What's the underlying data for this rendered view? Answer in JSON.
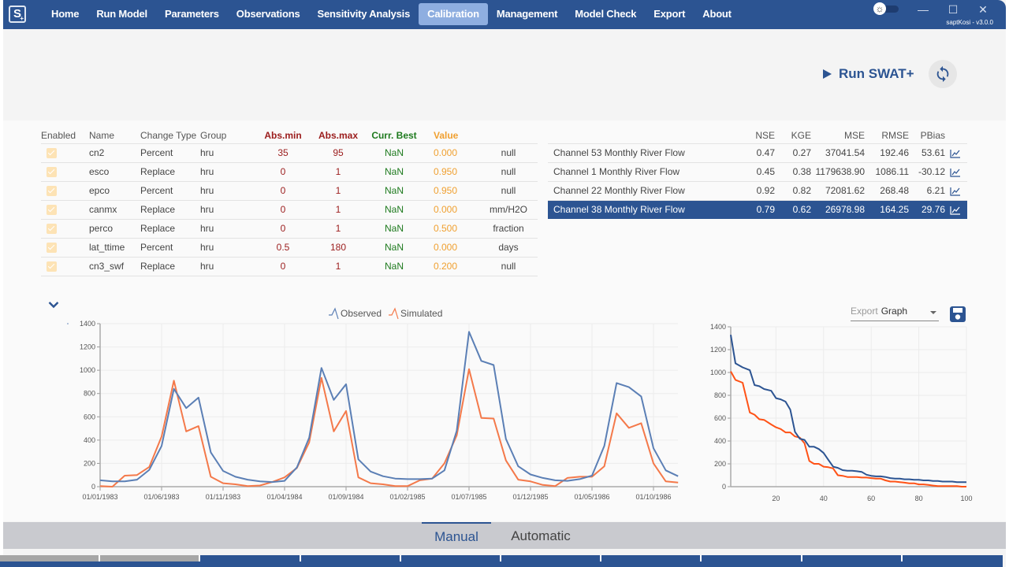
{
  "app": {
    "logo_text": "S",
    "logo_sub": "+",
    "project": "saptKosi",
    "version_label": "saptKosi  - v3.0.0"
  },
  "nav": {
    "items": [
      {
        "label": "Home"
      },
      {
        "label": "Run Model"
      },
      {
        "label": "Parameters"
      },
      {
        "label": "Observations"
      },
      {
        "label": "Sensitivity Analysis"
      },
      {
        "label": "Calibration",
        "active": true
      },
      {
        "label": "Management"
      },
      {
        "label": "Model Check"
      },
      {
        "label": "Export"
      },
      {
        "label": "About"
      }
    ]
  },
  "window": {
    "minimize": "—",
    "maximize": "☐",
    "close": "✕"
  },
  "actions": {
    "run_label": "Run SWAT+",
    "refresh_icon": "refresh-icon"
  },
  "params_table": {
    "headers": {
      "enabled": "Enabled",
      "name": "Name",
      "change_type": "Change Type",
      "group": "Group",
      "abs_min": "Abs.min",
      "abs_max": "Abs.max",
      "curr_best": "Curr. Best",
      "value": "Value"
    },
    "rows": [
      {
        "enabled": true,
        "name": "cn2",
        "change_type": "Percent",
        "group": "hru",
        "abs_min": "35",
        "abs_max": "95",
        "curr_best": "NaN",
        "value": "0.000",
        "unit": "null"
      },
      {
        "enabled": true,
        "name": "esco",
        "change_type": "Replace",
        "group": "hru",
        "abs_min": "0",
        "abs_max": "1",
        "curr_best": "NaN",
        "value": "0.950",
        "unit": "null"
      },
      {
        "enabled": true,
        "name": "epco",
        "change_type": "Percent",
        "group": "hru",
        "abs_min": "0",
        "abs_max": "1",
        "curr_best": "NaN",
        "value": "0.950",
        "unit": "null"
      },
      {
        "enabled": true,
        "name": "canmx",
        "change_type": "Replace",
        "group": "hru",
        "abs_min": "0",
        "abs_max": "1",
        "curr_best": "NaN",
        "value": "0.000",
        "unit": "mm/H2O"
      },
      {
        "enabled": true,
        "name": "perco",
        "change_type": "Replace",
        "group": "hru",
        "abs_min": "0",
        "abs_max": "1",
        "curr_best": "NaN",
        "value": "0.500",
        "unit": "fraction"
      },
      {
        "enabled": true,
        "name": "lat_ttime",
        "change_type": "Percent",
        "group": "hru",
        "abs_min": "0.5",
        "abs_max": "180",
        "curr_best": "NaN",
        "value": "0.000",
        "unit": "days"
      },
      {
        "enabled": true,
        "name": "cn3_swf",
        "change_type": "Replace",
        "group": "hru",
        "abs_min": "0",
        "abs_max": "1",
        "curr_best": "NaN",
        "value": "0.200",
        "unit": "null"
      }
    ]
  },
  "metrics_table": {
    "headers": {
      "nse": "NSE",
      "kge": "KGE",
      "mse": "MSE",
      "rmse": "RMSE",
      "pbias": "PBias"
    },
    "rows": [
      {
        "name": "Channel 53 Monthly River Flow",
        "nse": "0.47",
        "kge": "0.27",
        "mse": "37041.54",
        "rmse": "192.46",
        "pbias": "53.61",
        "selected": false
      },
      {
        "name": "Channel 1 Monthly River Flow",
        "nse": "0.45",
        "kge": "0.38",
        "mse": "1179638.90",
        "rmse": "1086.11",
        "pbias": "-30.12",
        "selected": false
      },
      {
        "name": "Channel 22 Monthly River Flow",
        "nse": "0.92",
        "kge": "0.82",
        "mse": "72081.62",
        "rmse": "268.48",
        "pbias": "6.21",
        "selected": false
      },
      {
        "name": "Channel 38 Monthly River Flow",
        "nse": "0.79",
        "kge": "0.62",
        "mse": "26978.98",
        "rmse": "164.25",
        "pbias": "29.76",
        "selected": true
      }
    ]
  },
  "export": {
    "label": "Export",
    "value": "Graph"
  },
  "colors": {
    "primary": "#2c5492",
    "observed": "#5b7fb5",
    "simulated": "#f4794a",
    "fdc_observed": "#2c5492",
    "fdc_simulated": "#ff5216",
    "nav_active": "#8eaee0"
  },
  "tabs": [
    {
      "label": "Manual",
      "active": true
    },
    {
      "label": "Automatic",
      "active": false
    }
  ],
  "chart_data": [
    {
      "type": "line",
      "title": "",
      "xlabel": "",
      "ylabel": "",
      "legend": [
        "Observed",
        "Simulated"
      ],
      "legend_position": "top-center",
      "ylim": [
        0,
        1400
      ],
      "yticks": [
        0,
        200,
        400,
        600,
        800,
        1000,
        1200,
        1400
      ],
      "x_start": "01/01/1983",
      "x_interval": "monthly",
      "xtick_labels": [
        "01/01/1983",
        "01/06/1983",
        "01/11/1983",
        "01/04/1984",
        "01/09/1984",
        "01/02/1985",
        "01/07/1985",
        "01/12/1985",
        "01/05/1986",
        "01/10/1986"
      ],
      "xtick_index": [
        0,
        5,
        10,
        15,
        20,
        25,
        30,
        35,
        40,
        45
      ],
      "grid": true,
      "series": [
        {
          "name": "Observed",
          "values": [
            55,
            45,
            45,
            60,
            145,
            350,
            840,
            675,
            765,
            295,
            135,
            85,
            60,
            45,
            40,
            50,
            165,
            420,
            1020,
            745,
            880,
            235,
            130,
            90,
            70,
            65,
            65,
            70,
            140,
            480,
            1330,
            1080,
            1045,
            410,
            175,
            105,
            75,
            55,
            50,
            65,
            95,
            350,
            890,
            855,
            775,
            330,
            140,
            90
          ]
        },
        {
          "name": "Simulated",
          "values": [
            5,
            0,
            95,
            100,
            170,
            430,
            910,
            475,
            520,
            85,
            30,
            20,
            5,
            10,
            40,
            80,
            160,
            380,
            935,
            475,
            650,
            80,
            30,
            20,
            5,
            5,
            55,
            70,
            200,
            440,
            1010,
            590,
            585,
            225,
            60,
            45,
            15,
            5,
            75,
            85,
            85,
            175,
            630,
            505,
            545,
            200,
            45,
            35
          ]
        }
      ]
    },
    {
      "type": "line",
      "title": "",
      "xlabel": "",
      "ylabel": "",
      "ylim": [
        0,
        1400
      ],
      "xlim": [
        1,
        100
      ],
      "yticks": [
        0,
        200,
        400,
        600,
        800,
        1000,
        1200,
        1400
      ],
      "xticks": [
        20,
        40,
        60,
        80,
        100
      ],
      "grid": true,
      "series": [
        {
          "name": "Observed",
          "x": [
            1,
            3,
            6,
            9,
            11,
            13,
            15,
            18,
            20,
            22,
            24,
            26,
            28,
            30,
            32,
            34,
            36,
            38,
            40,
            42,
            44,
            46,
            48,
            50,
            52,
            54,
            56,
            58,
            60,
            62,
            64,
            66,
            68,
            70,
            72,
            74,
            76,
            78,
            80,
            82,
            84,
            86,
            88,
            90,
            92,
            94,
            96,
            98,
            100
          ],
          "values": [
            1330,
            1080,
            1045,
            1020,
            890,
            880,
            855,
            840,
            775,
            765,
            745,
            675,
            480,
            420,
            410,
            350,
            350,
            330,
            295,
            235,
            175,
            165,
            145,
            140,
            140,
            135,
            130,
            105,
            95,
            90,
            90,
            85,
            75,
            70,
            70,
            65,
            65,
            60,
            60,
            55,
            55,
            50,
            50,
            45,
            45,
            45,
            40,
            40,
            40
          ]
        },
        {
          "name": "Simulated",
          "x": [
            1,
            3,
            6,
            9,
            11,
            13,
            15,
            18,
            20,
            22,
            24,
            26,
            28,
            30,
            32,
            34,
            36,
            38,
            40,
            42,
            44,
            46,
            48,
            50,
            52,
            54,
            56,
            58,
            60,
            62,
            64,
            66,
            68,
            70,
            72,
            74,
            76,
            78,
            80,
            82,
            84,
            86,
            88,
            90,
            92,
            94,
            96,
            98,
            100
          ],
          "values": [
            1010,
            935,
            910,
            650,
            630,
            590,
            585,
            545,
            520,
            505,
            475,
            475,
            440,
            430,
            380,
            225,
            200,
            200,
            175,
            170,
            160,
            100,
            95,
            85,
            85,
            85,
            80,
            80,
            75,
            70,
            70,
            55,
            45,
            45,
            40,
            35,
            30,
            30,
            20,
            20,
            15,
            10,
            5,
            5,
            5,
            5,
            5,
            0,
            0
          ]
        }
      ]
    }
  ]
}
